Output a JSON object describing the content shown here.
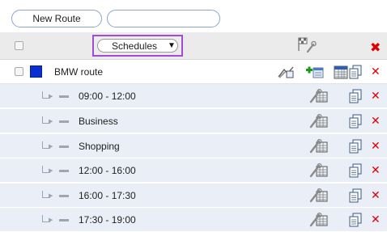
{
  "toolbar": {
    "new_route_label": "New Route",
    "search_value": ""
  },
  "header": {
    "schedule_select": "Schedules"
  },
  "route": {
    "name": "BMW route",
    "color": "#0a2fd0"
  },
  "schedules": [
    {
      "label": "09:00 - 12:00"
    },
    {
      "label": "Business"
    },
    {
      "label": "Shopping"
    },
    {
      "label": "12:00 - 16:00"
    },
    {
      "label": "16:00 - 17:30"
    },
    {
      "label": "17:30 - 19:00"
    }
  ],
  "icons": {
    "header": [
      "flag-settings-icon",
      "close-icon"
    ],
    "route": [
      "route-edit-icon",
      "add-schedule-icon",
      "calendar-icon",
      "copy-icon",
      "close-icon"
    ],
    "schedule": [
      "schedule-edit-icon",
      "copy-icon",
      "close-icon"
    ]
  },
  "colors": {
    "accent_select_border": "#a14bd6",
    "delete_red": "#e00000",
    "row_blue": "#e9eef7"
  }
}
